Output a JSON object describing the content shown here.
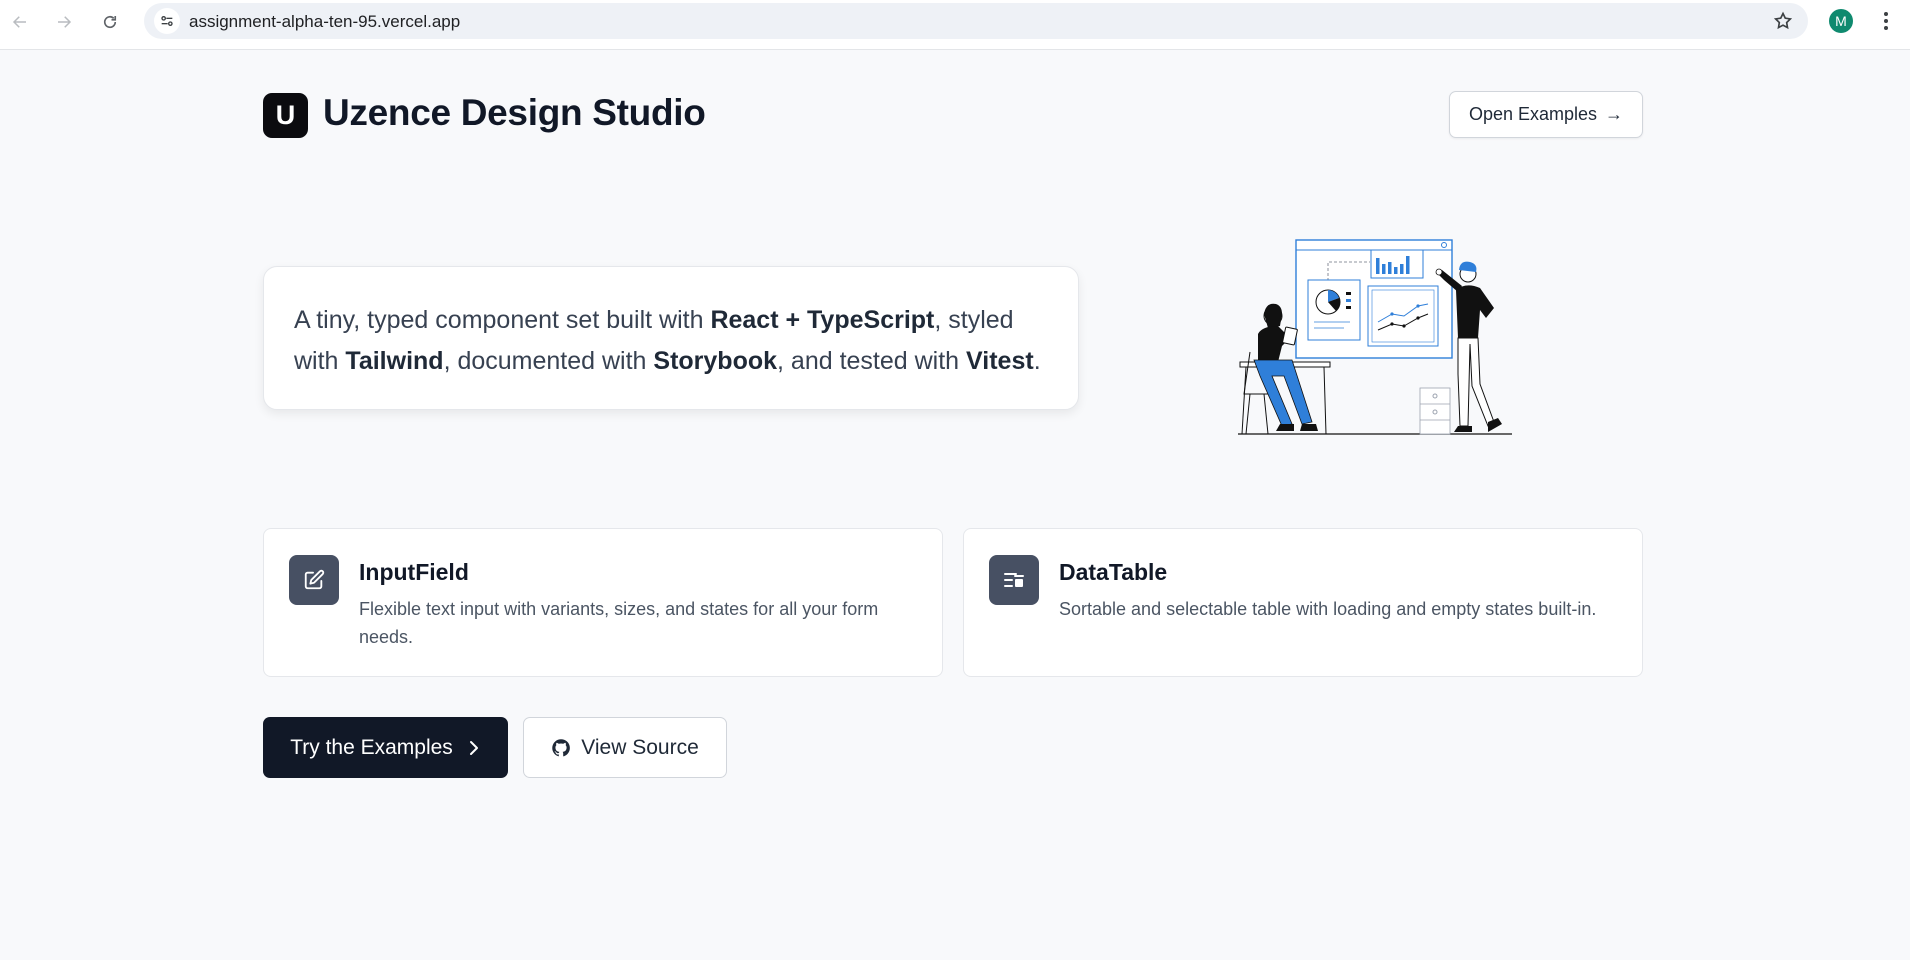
{
  "browser": {
    "url": "assignment-alpha-ten-95.vercel.app",
    "profile_initial": "M"
  },
  "header": {
    "logo_letter": "U",
    "title": "Uzence Design Studio",
    "open_examples_label": "Open Examples",
    "open_examples_arrow": "→"
  },
  "intro": {
    "t1": "A tiny, typed component set built with ",
    "b1": "React + TypeScript",
    "t2": ", styled with ",
    "b2": "Tailwind",
    "t3": ", documented with ",
    "b3": "Storybook",
    "t4": ", and tested with ",
    "b4": "Vitest",
    "t5": "."
  },
  "features": [
    {
      "title": "InputField",
      "description": "Flexible text input with variants, sizes, and states for all your form needs.",
      "icon": "edit-icon"
    },
    {
      "title": "DataTable",
      "description": "Sortable and selectable table with loading and empty states built-in.",
      "icon": "table-icon"
    }
  ],
  "cta": {
    "primary_label": "Try the Examples",
    "secondary_label": "View Source"
  },
  "colors": {
    "page_bg": "#f8f9fb",
    "primary": "#111827",
    "icon_bg": "#475063",
    "accent_blue": "#2f7fd9"
  }
}
